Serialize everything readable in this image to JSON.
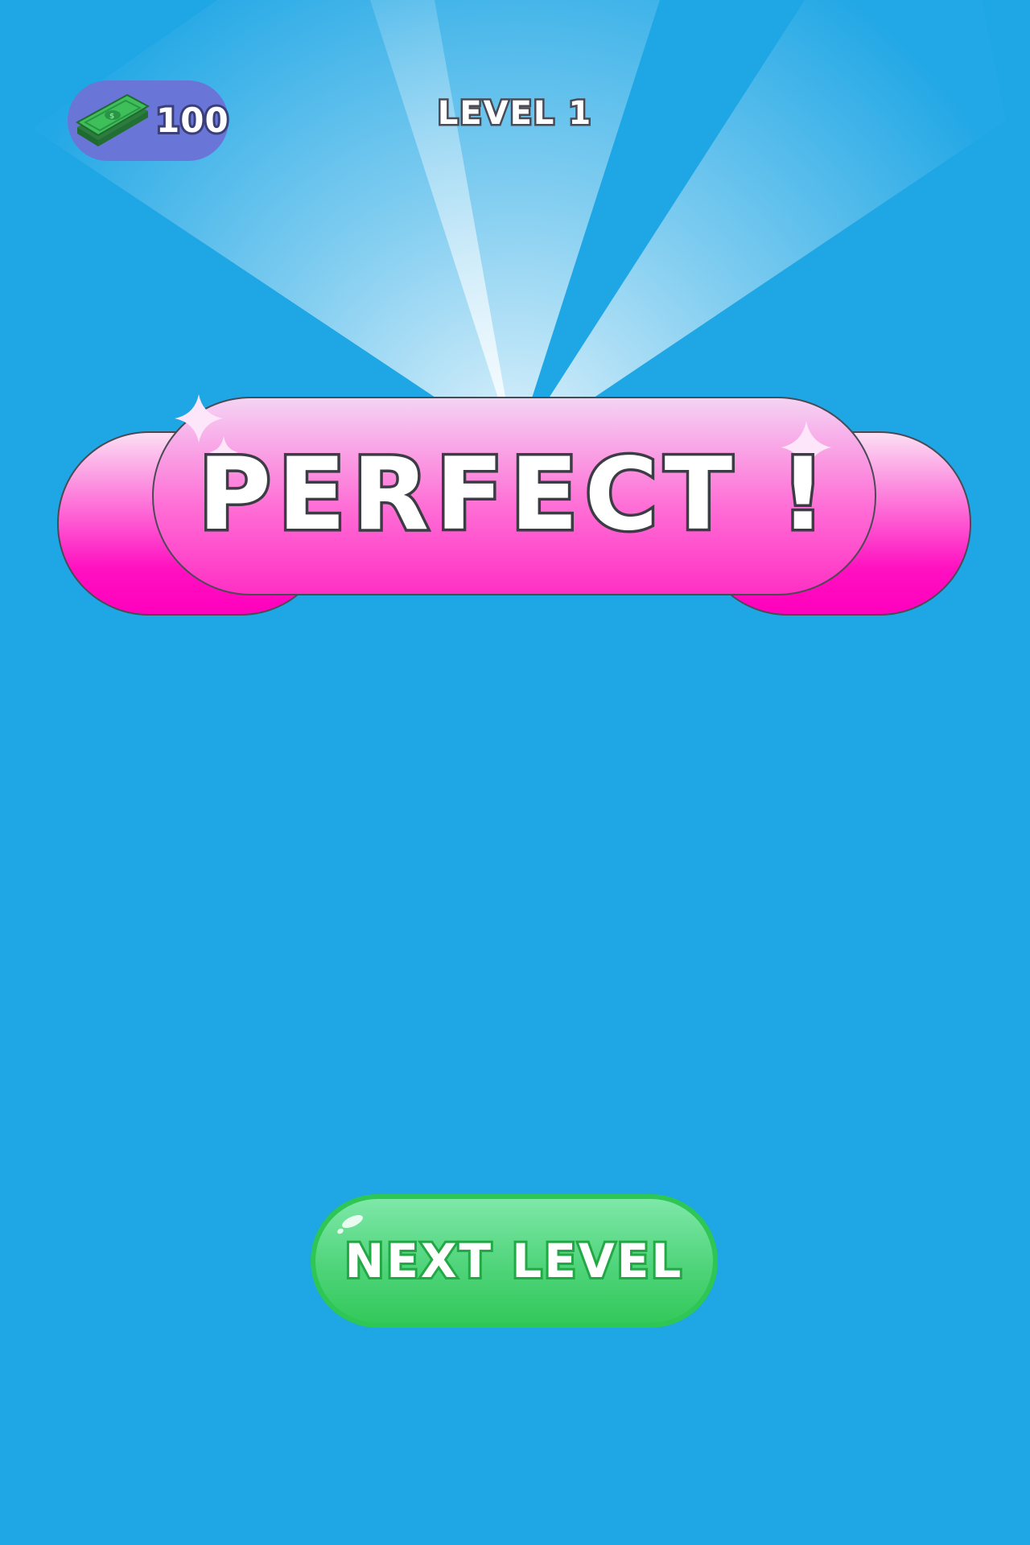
{
  "hud": {
    "currency_icon": "cash-bill-icon",
    "currency_amount": "100",
    "level_title": "LEVEL 1"
  },
  "banner": {
    "text": "PERFECT !",
    "decorations": "sparkle-icon"
  },
  "actions": {
    "next_level_label": "NEXT LEVEL"
  },
  "colors": {
    "background": "#1ea6e5",
    "currency_pill": "#6a75d8",
    "banner_pink": "#ff33c4",
    "button_green": "#33c95b"
  }
}
